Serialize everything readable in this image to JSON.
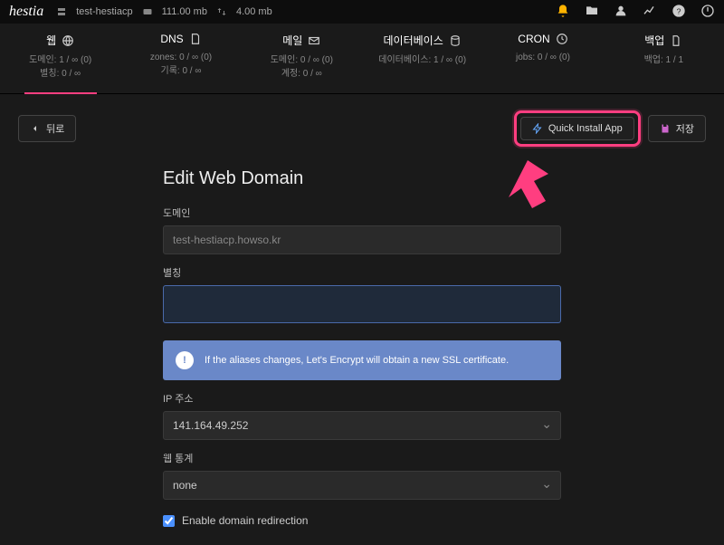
{
  "topbar": {
    "logo": "hestia",
    "host": "test-hestiacp",
    "disk_label": "111.00 mb",
    "bw_label": "4.00 mb"
  },
  "tabs": [
    {
      "name": "웹",
      "l1": "도메인: 1 / ∞  (0)",
      "l2": "별칭: 0 / ∞",
      "active": true,
      "icon": "globe"
    },
    {
      "name": "DNS",
      "l1": "zones: 0 / ∞  (0)",
      "l2": "기록: 0 / ∞",
      "icon": "file"
    },
    {
      "name": "메일",
      "l1": "도메인: 0 / ∞  (0)",
      "l2": "계정: 0 / ∞",
      "icon": "mail"
    },
    {
      "name": "데이터베이스",
      "l1": "데이터베이스: 1 / ∞  (0)",
      "l2": "",
      "icon": "db"
    },
    {
      "name": "CRON",
      "l1": "jobs: 0 / ∞  (0)",
      "l2": "",
      "icon": "clock"
    },
    {
      "name": "백업",
      "l1": "백업: 1 / 1",
      "l2": "",
      "icon": "doc"
    }
  ],
  "toolbar": {
    "back": "뒤로",
    "quick": "Quick Install App",
    "save": "저장"
  },
  "form": {
    "title": "Edit Web Domain",
    "domain_label": "도메인",
    "domain_value": "test-hestiacp.howso.kr",
    "alias_label": "별칭",
    "alias_value": "",
    "alert": "If the aliases changes, Let's Encrypt will obtain a new SSL certificate.",
    "ip_label": "IP 주소",
    "ip_value": "141.164.49.252",
    "stats_label": "웹 통계",
    "stats_value": "none",
    "redir_label": "Enable domain redirection",
    "redir_checked": true
  }
}
